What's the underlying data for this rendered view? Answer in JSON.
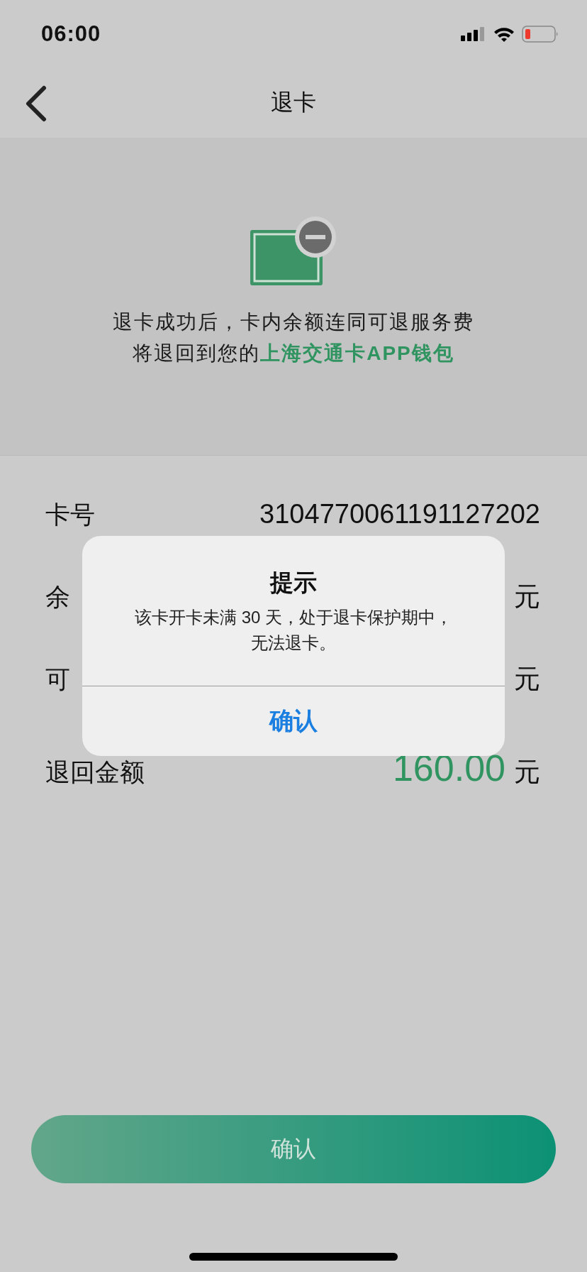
{
  "status_bar": {
    "time": "06:00"
  },
  "nav": {
    "title": "退卡"
  },
  "notice": {
    "line_1": "退卡成功后，卡内余额连同可退服务费",
    "line_2_prefix": "将退回到您的",
    "line_2_link": "上海交通卡APP钱包"
  },
  "rows": [
    {
      "label": "卡号",
      "value": "3104770061191127202",
      "kind": "plain"
    },
    {
      "label": "余",
      "unit": "元",
      "kind": "plain"
    },
    {
      "label": "可",
      "unit": "元",
      "kind": "plain"
    },
    {
      "label": "退回金额",
      "value": "160.00",
      "unit": "元",
      "kind": "highlight"
    }
  ],
  "confirm_button": {
    "label": "确认"
  },
  "alert": {
    "title": "提示",
    "message": "该卡开卡未满 30 天，处于退卡保护期中，无法退卡。",
    "button": "确认"
  }
}
